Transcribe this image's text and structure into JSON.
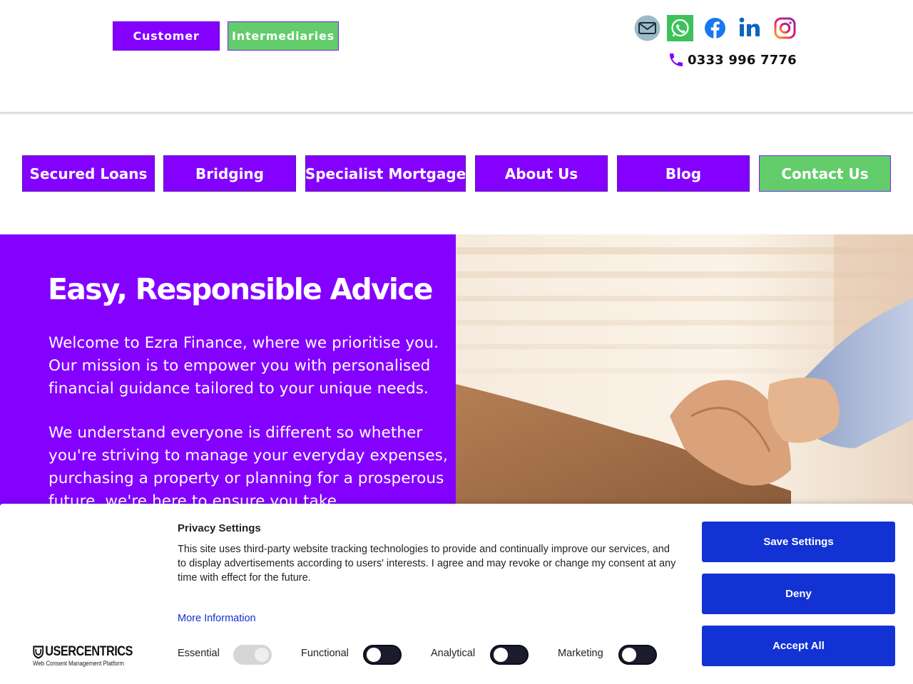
{
  "header": {
    "customer_label": "Customer",
    "intermediaries_label": "Intermediaries",
    "phone": "0333 996 7776",
    "social_icons": [
      "email-icon",
      "whatsapp-icon",
      "facebook-icon",
      "linkedin-icon",
      "instagram-icon"
    ]
  },
  "nav": {
    "items": [
      {
        "label": "Secured Loans"
      },
      {
        "label": "Bridging"
      },
      {
        "label": "Specialist Mortgage"
      },
      {
        "label": "About Us"
      },
      {
        "label": "Blog"
      },
      {
        "label": "Contact Us"
      }
    ]
  },
  "hero": {
    "title": "Easy, Responsible Advice",
    "paragraph1": "Welcome to Ezra Finance, where we prioritise you. Our mission is to empower you with personalised financial guidance tailored to your unique needs.",
    "paragraph2": "We understand everyone is different so whether you're striving to manage your everyday expenses, purchasing a property or planning for a prosperous future, we're here to ensure you take"
  },
  "cookie_banner": {
    "title": "Privacy Settings",
    "text": "This site uses third-party website tracking technologies to provide and continually improve our services, and to display advertisements according to users' interests. I agree and may revoke or change my consent at any time with effect for the future.",
    "more_info": "More Information",
    "toggles": [
      {
        "label": "Essential",
        "enabled": true,
        "locked": true
      },
      {
        "label": "Functional",
        "enabled": false
      },
      {
        "label": "Analytical",
        "enabled": false
      },
      {
        "label": "Marketing",
        "enabled": false
      }
    ],
    "buttons": {
      "save": "Save Settings",
      "deny": "Deny",
      "accept": "Accept All"
    },
    "brand": "USERCENTRICS",
    "brand_sub": "Web Consent Management Platform"
  },
  "colors": {
    "brand_purple": "#8400ff",
    "brand_green": "#62cd6a",
    "consent_blue": "#1232d3"
  }
}
